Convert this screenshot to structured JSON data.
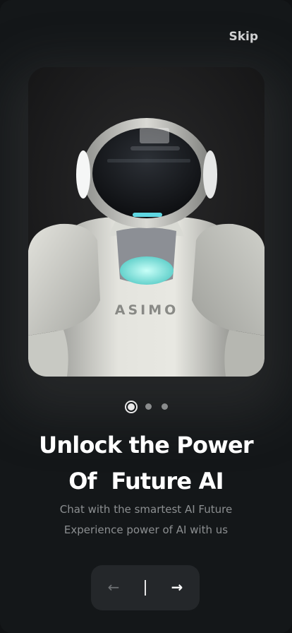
{
  "onboarding": {
    "skip_label": "Skip",
    "hero_image": {
      "description_icon": "humanoid-robot-image"
    },
    "pagination": {
      "total": 3,
      "active": 1
    },
    "title_line1": "Unlock the Power",
    "title_line2": "Of  Future AI",
    "subtitle_line1": "Chat with the smartest AI Future",
    "subtitle_line2": "Experience power of AI with us",
    "nav": {
      "prev_icon": "arrow-left-icon",
      "prev_glyph": "←",
      "next_icon": "arrow-right-icon",
      "next_glyph": "→"
    }
  },
  "colors": {
    "background": "#141719",
    "text_primary": "#ffffff",
    "text_secondary": "#8c8f91",
    "nav_background": "#24272a",
    "dot_inactive": "#8a8c8d"
  }
}
